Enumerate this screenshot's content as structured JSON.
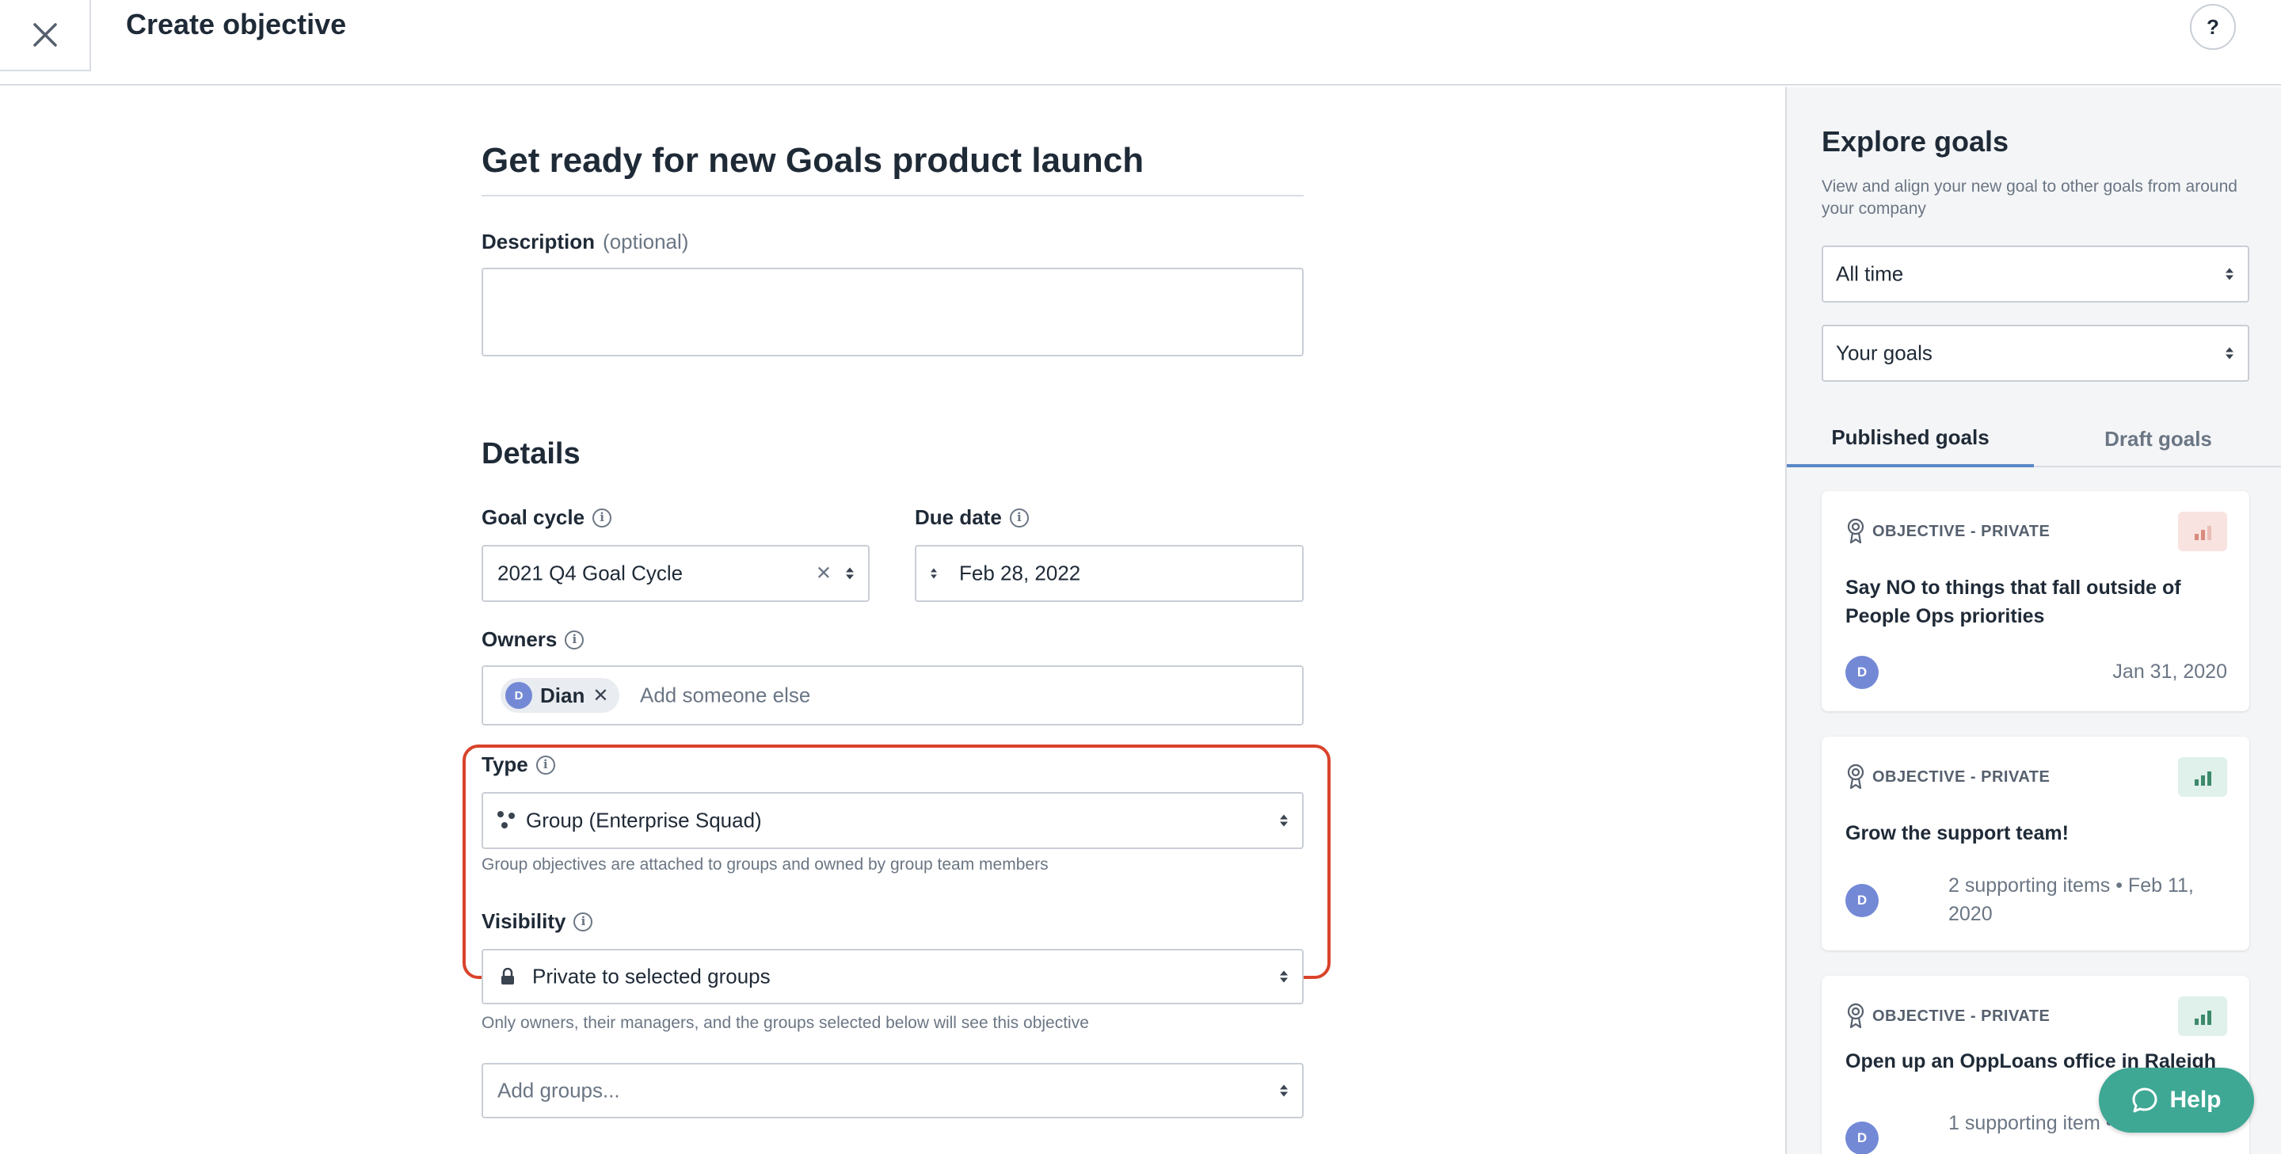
{
  "header": {
    "title": "Create objective",
    "help_glyph": "?"
  },
  "form": {
    "objective_title": "Get ready for new Goals product launch",
    "description_label": "Description",
    "description_optional": "(optional)",
    "description_value": "",
    "details_title": "Details",
    "goal_cycle_label": "Goal cycle",
    "goal_cycle_value": "2021 Q4 Goal Cycle",
    "due_date_label": "Due date",
    "due_date_value": "Feb 28, 2022",
    "owners_label": "Owners",
    "owner_chip": {
      "initial": "D",
      "name": "Dian"
    },
    "owners_placeholder": "Add someone else",
    "type_label": "Type",
    "type_value": "Group (Enterprise Squad)",
    "type_hint": "Group objectives are attached to groups and owned by group team members",
    "visibility_label": "Visibility",
    "visibility_value": "Private to selected groups",
    "visibility_hint": "Only owners, their managers, and the groups selected below will see this objective",
    "groups_placeholder": "Add groups..."
  },
  "panel": {
    "title": "Explore goals",
    "subtitle": "View and align your new goal to other goals from around your company",
    "time_filter": "All time",
    "scope_filter": "Your goals",
    "tabs": [
      {
        "label": "Published goals",
        "active": true
      },
      {
        "label": "Draft goals",
        "active": false
      }
    ],
    "cards": [
      {
        "kind": "OBJECTIVE - PRIVATE",
        "title": "Say NO to things that fall outside of People Ops priorities",
        "avatar": "D",
        "meta": "Jan 31, 2020",
        "status": "at-risk"
      },
      {
        "kind": "OBJECTIVE - PRIVATE",
        "title": "Grow the support team!",
        "avatar": "D",
        "meta": "2 supporting items • Feb 11, 2020",
        "status": "on-track"
      },
      {
        "kind": "OBJECTIVE - PRIVATE",
        "title": "Open up an OppLoans office in Raleigh",
        "avatar": "D",
        "meta": "1 supporting item • 2020",
        "status": "on-track"
      }
    ]
  },
  "help_button": {
    "label": "Help"
  },
  "colors": {
    "highlight": "#d9432a",
    "help_button": "#3ea894",
    "avatar": "#7489d6",
    "tab_underline": "#5b87c7",
    "at_risk_badge": "#f8e3e0",
    "on_track_badge": "#e0f0ea"
  }
}
